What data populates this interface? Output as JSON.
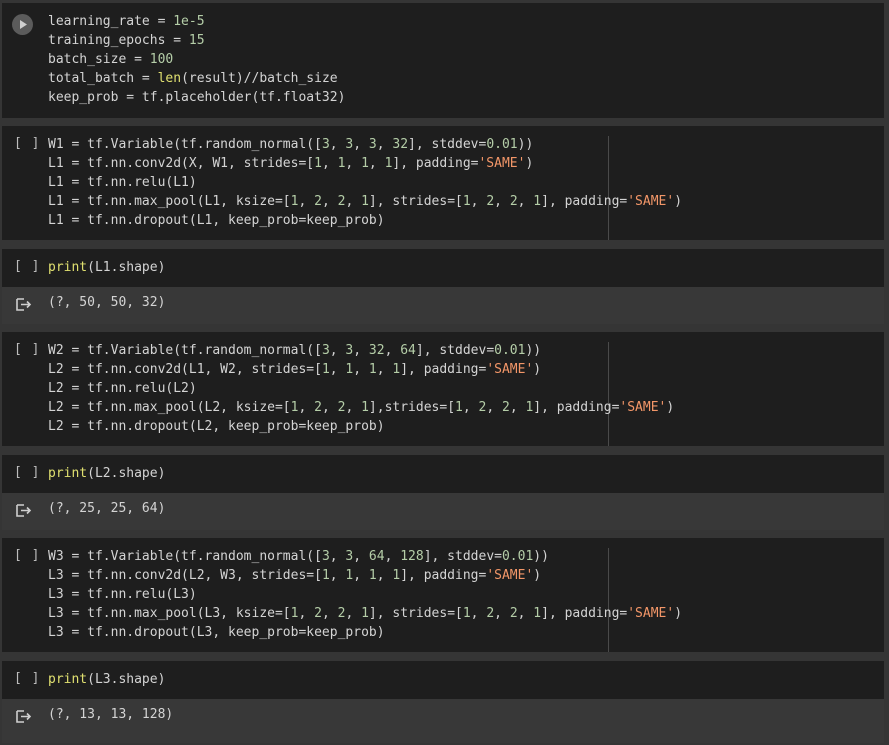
{
  "cells": [
    {
      "id": "cell-1",
      "bracket": "",
      "has_run_button": true,
      "lines": [
        [
          {
            "t": "learning_rate = "
          },
          {
            "t": "1e-5",
            "c": "num"
          }
        ],
        [
          {
            "t": "training_epochs = "
          },
          {
            "t": "15",
            "c": "num"
          }
        ],
        [
          {
            "t": "batch_size = "
          },
          {
            "t": "100",
            "c": "num"
          }
        ],
        [
          {
            "t": "total_batch = "
          },
          {
            "t": "len",
            "c": "fn"
          },
          {
            "t": "(result)//batch_size"
          }
        ],
        [
          {
            "t": "keep_prob = tf.placeholder(tf.float32)"
          }
        ]
      ]
    },
    {
      "id": "cell-2",
      "bracket": "[ ]",
      "lines": [
        [
          {
            "t": "W1 = tf.Variable(tf.random_normal(["
          },
          {
            "t": "3",
            "c": "num"
          },
          {
            "t": ", "
          },
          {
            "t": "3",
            "c": "num"
          },
          {
            "t": ", "
          },
          {
            "t": "3",
            "c": "num"
          },
          {
            "t": ", "
          },
          {
            "t": "32",
            "c": "num"
          },
          {
            "t": "], stddev="
          },
          {
            "t": "0.01",
            "c": "num"
          },
          {
            "t": "))"
          }
        ],
        [
          {
            "t": "L1 = tf.nn.conv2d(X, W1, strides=["
          },
          {
            "t": "1",
            "c": "num"
          },
          {
            "t": ", "
          },
          {
            "t": "1",
            "c": "num"
          },
          {
            "t": ", "
          },
          {
            "t": "1",
            "c": "num"
          },
          {
            "t": ", "
          },
          {
            "t": "1",
            "c": "num"
          },
          {
            "t": "], padding="
          },
          {
            "t": "'SAME'",
            "c": "str"
          },
          {
            "t": ")"
          }
        ],
        [
          {
            "t": "L1 = tf.nn.relu(L1)"
          }
        ],
        [
          {
            "t": "L1 = tf.nn.max_pool(L1, ksize=["
          },
          {
            "t": "1",
            "c": "num"
          },
          {
            "t": ", "
          },
          {
            "t": "2",
            "c": "num"
          },
          {
            "t": ", "
          },
          {
            "t": "2",
            "c": "num"
          },
          {
            "t": ", "
          },
          {
            "t": "1",
            "c": "num"
          },
          {
            "t": "], strides=["
          },
          {
            "t": "1",
            "c": "num"
          },
          {
            "t": ", "
          },
          {
            "t": "2",
            "c": "num"
          },
          {
            "t": ", "
          },
          {
            "t": "2",
            "c": "num"
          },
          {
            "t": ", "
          },
          {
            "t": "1",
            "c": "num"
          },
          {
            "t": "], padding="
          },
          {
            "t": "'SAME'",
            "c": "str"
          },
          {
            "t": ")"
          }
        ],
        [
          {
            "t": "L1 = tf.nn.dropout(L1, keep_prob=keep_prob)"
          }
        ]
      ]
    },
    {
      "id": "cell-3",
      "bracket": "[ ]",
      "lines": [
        [
          {
            "t": "print",
            "c": "fn"
          },
          {
            "t": "(L1.shape)"
          }
        ]
      ],
      "output": "(?, 50, 50, 32)"
    },
    {
      "id": "cell-4",
      "bracket": "[ ]",
      "lines": [
        [
          {
            "t": "W2 = tf.Variable(tf.random_normal(["
          },
          {
            "t": "3",
            "c": "num"
          },
          {
            "t": ", "
          },
          {
            "t": "3",
            "c": "num"
          },
          {
            "t": ", "
          },
          {
            "t": "32",
            "c": "num"
          },
          {
            "t": ", "
          },
          {
            "t": "64",
            "c": "num"
          },
          {
            "t": "], stddev="
          },
          {
            "t": "0.01",
            "c": "num"
          },
          {
            "t": "))"
          }
        ],
        [
          {
            "t": "L2 = tf.nn.conv2d(L1, W2, strides=["
          },
          {
            "t": "1",
            "c": "num"
          },
          {
            "t": ", "
          },
          {
            "t": "1",
            "c": "num"
          },
          {
            "t": ", "
          },
          {
            "t": "1",
            "c": "num"
          },
          {
            "t": ", "
          },
          {
            "t": "1",
            "c": "num"
          },
          {
            "t": "], padding="
          },
          {
            "t": "'SAME'",
            "c": "str"
          },
          {
            "t": ")"
          }
        ],
        [
          {
            "t": "L2 = tf.nn.relu(L2)"
          }
        ],
        [
          {
            "t": "L2 = tf.nn.max_pool(L2, ksize=["
          },
          {
            "t": "1",
            "c": "num"
          },
          {
            "t": ", "
          },
          {
            "t": "2",
            "c": "num"
          },
          {
            "t": ", "
          },
          {
            "t": "2",
            "c": "num"
          },
          {
            "t": ", "
          },
          {
            "t": "1",
            "c": "num"
          },
          {
            "t": "],strides=["
          },
          {
            "t": "1",
            "c": "num"
          },
          {
            "t": ", "
          },
          {
            "t": "2",
            "c": "num"
          },
          {
            "t": ", "
          },
          {
            "t": "2",
            "c": "num"
          },
          {
            "t": ", "
          },
          {
            "t": "1",
            "c": "num"
          },
          {
            "t": "], padding="
          },
          {
            "t": "'SAME'",
            "c": "str"
          },
          {
            "t": ")"
          }
        ],
        [
          {
            "t": "L2 = tf.nn.dropout(L2, keep_prob=keep_prob)"
          }
        ]
      ]
    },
    {
      "id": "cell-5",
      "bracket": "[ ]",
      "lines": [
        [
          {
            "t": "print",
            "c": "fn"
          },
          {
            "t": "(L2.shape)"
          }
        ]
      ],
      "output": "(?, 25, 25, 64)"
    },
    {
      "id": "cell-6",
      "bracket": "[ ]",
      "lines": [
        [
          {
            "t": "W3 = tf.Variable(tf.random_normal(["
          },
          {
            "t": "3",
            "c": "num"
          },
          {
            "t": ", "
          },
          {
            "t": "3",
            "c": "num"
          },
          {
            "t": ", "
          },
          {
            "t": "64",
            "c": "num"
          },
          {
            "t": ", "
          },
          {
            "t": "128",
            "c": "num"
          },
          {
            "t": "], stddev="
          },
          {
            "t": "0.01",
            "c": "num"
          },
          {
            "t": "))"
          }
        ],
        [
          {
            "t": "L3 = tf.nn.conv2d(L2, W3, strides=["
          },
          {
            "t": "1",
            "c": "num"
          },
          {
            "t": ", "
          },
          {
            "t": "1",
            "c": "num"
          },
          {
            "t": ", "
          },
          {
            "t": "1",
            "c": "num"
          },
          {
            "t": ", "
          },
          {
            "t": "1",
            "c": "num"
          },
          {
            "t": "], padding="
          },
          {
            "t": "'SAME'",
            "c": "str"
          },
          {
            "t": ")"
          }
        ],
        [
          {
            "t": "L3 = tf.nn.relu(L3)"
          }
        ],
        [
          {
            "t": "L3 = tf.nn.max_pool(L3, ksize=["
          },
          {
            "t": "1",
            "c": "num"
          },
          {
            "t": ", "
          },
          {
            "t": "2",
            "c": "num"
          },
          {
            "t": ", "
          },
          {
            "t": "2",
            "c": "num"
          },
          {
            "t": ", "
          },
          {
            "t": "1",
            "c": "num"
          },
          {
            "t": "], strides=["
          },
          {
            "t": "1",
            "c": "num"
          },
          {
            "t": ", "
          },
          {
            "t": "2",
            "c": "num"
          },
          {
            "t": ", "
          },
          {
            "t": "2",
            "c": "num"
          },
          {
            "t": ", "
          },
          {
            "t": "1",
            "c": "num"
          },
          {
            "t": "], padding="
          },
          {
            "t": "'SAME'",
            "c": "str"
          },
          {
            "t": ")"
          }
        ],
        [
          {
            "t": "L3 = tf.nn.dropout(L3, keep_prob=keep_prob)"
          }
        ]
      ]
    },
    {
      "id": "cell-7",
      "bracket": "[ ]",
      "lines": [
        [
          {
            "t": "print",
            "c": "fn"
          },
          {
            "t": "(L3.shape)"
          }
        ]
      ],
      "output": "(?, 13, 13, 128)"
    }
  ],
  "theme": {
    "background": "#353535",
    "cell_bg": "#1e1e1e",
    "output_bg": "#383838",
    "string_color": "#f29668",
    "number_color": "#b5cea8",
    "builtin_color": "#e0e070",
    "text_color": "#d4d4d4"
  },
  "icons": {
    "run": "play-circle-icon",
    "output": "output-arrow-icon"
  }
}
